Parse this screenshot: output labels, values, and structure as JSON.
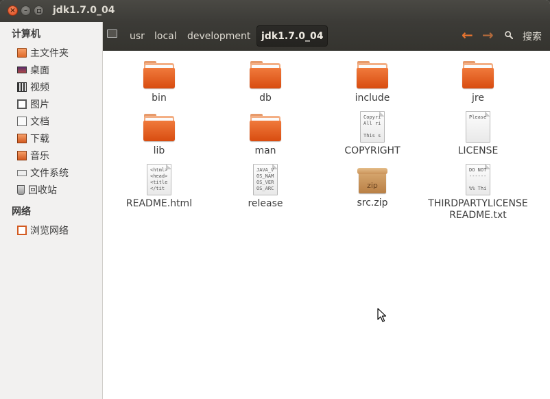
{
  "window": {
    "title": "jdk1.7.0_04",
    "controls": {
      "close": "×",
      "minimize": "–"
    }
  },
  "sidebar": {
    "computer_heading": "计算机",
    "computer_items": [
      {
        "label": "主文件夹",
        "icon": "home-folder-icon"
      },
      {
        "label": "桌面",
        "icon": "desktop-icon"
      },
      {
        "label": "视频",
        "icon": "video-icon"
      },
      {
        "label": "图片",
        "icon": "pictures-icon"
      },
      {
        "label": "文档",
        "icon": "documents-icon"
      },
      {
        "label": "下载",
        "icon": "downloads-icon"
      },
      {
        "label": "音乐",
        "icon": "music-icon"
      },
      {
        "label": "文件系统",
        "icon": "filesystem-icon"
      },
      {
        "label": "回收站",
        "icon": "trash-icon"
      }
    ],
    "network_heading": "网络",
    "network_items": [
      {
        "label": "浏览网络",
        "icon": "network-icon"
      }
    ]
  },
  "toolbar": {
    "breadcrumbs": [
      "usr",
      "local",
      "development",
      "jdk1.7.0_04"
    ],
    "back_arrow": "←",
    "forward_arrow": "→",
    "search_label": "搜索"
  },
  "files": [
    {
      "name": "bin",
      "type": "folder"
    },
    {
      "name": "db",
      "type": "folder"
    },
    {
      "name": "include",
      "type": "folder"
    },
    {
      "name": "jre",
      "type": "folder"
    },
    {
      "name": "lib",
      "type": "folder"
    },
    {
      "name": "man",
      "type": "folder"
    },
    {
      "name": "COPYRIGHT",
      "type": "text",
      "preview": "Copyri\nAll ri\n\nThis s"
    },
    {
      "name": "LICENSE",
      "type": "text",
      "preview": "Please"
    },
    {
      "name": "README.html",
      "type": "text",
      "preview": "<html>\n<head>\n<title\n</tit"
    },
    {
      "name": "release",
      "type": "text",
      "preview": "JAVA_V\nOS_NAM\nOS_VER\nOS_ARC"
    },
    {
      "name": "src.zip",
      "type": "archive",
      "badge": "zip"
    },
    {
      "name": "THIRDPARTYLICENSEREADME.txt",
      "type": "text",
      "preview": "DO NOT\n------\n\n%% Thi"
    }
  ],
  "colors": {
    "titlebar": "#3c3b37",
    "accent_orange": "#e8742f",
    "sidebar_bg": "#f2f1f0",
    "content_bg": "#ffffff"
  }
}
